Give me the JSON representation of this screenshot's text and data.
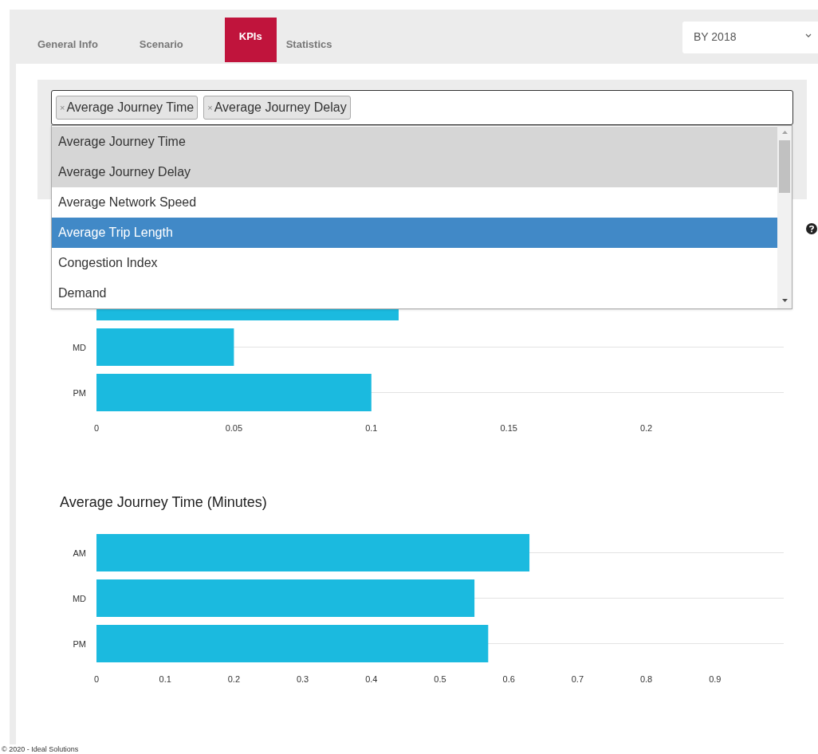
{
  "tabs": [
    {
      "label": "General Info",
      "selected": false
    },
    {
      "label": "Scenario",
      "selected": false
    },
    {
      "label": "KPIs",
      "selected": true
    },
    {
      "label": "Statistics",
      "selected": false
    }
  ],
  "year_select": {
    "value": "BY 2018"
  },
  "kpi_select": {
    "tags": [
      {
        "remove": "×",
        "label": "Average Journey Time"
      },
      {
        "remove": "×",
        "label": "Average Journey Delay"
      }
    ],
    "options": [
      {
        "label": "Average Journey Time",
        "selected": true,
        "hovered": false
      },
      {
        "label": "Average Journey Delay",
        "selected": true,
        "hovered": false
      },
      {
        "label": "Average Network Speed",
        "selected": false,
        "hovered": false
      },
      {
        "label": "Average Trip Length",
        "selected": false,
        "hovered": true
      },
      {
        "label": "Congestion Index",
        "selected": false,
        "hovered": false
      },
      {
        "label": "Demand",
        "selected": false,
        "hovered": false
      }
    ]
  },
  "charts": [
    {
      "clipped_bar": true,
      "chart_data": {
        "type": "bar",
        "orientation": "horizontal",
        "categories": [
          "MD",
          "PM"
        ],
        "series": [
          {
            "color": "#1bbadf",
            "values": [
              0.05,
              0.1
            ]
          }
        ],
        "xlim": [
          0,
          0.25
        ],
        "xticks": [
          0,
          0.05,
          0.1,
          0.15,
          0.2
        ]
      }
    },
    {
      "chart_data": {
        "type": "bar",
        "orientation": "horizontal",
        "title": "Average Journey Time (Minutes)",
        "categories": [
          "AM",
          "MD",
          "PM"
        ],
        "series": [
          {
            "color": "#1bbadf",
            "values": [
              0.63,
              0.55,
              0.57
            ]
          }
        ],
        "xlim": [
          0,
          1
        ],
        "xticks": [
          0,
          0.1,
          0.2,
          0.3,
          0.4,
          0.5,
          0.6,
          0.7,
          0.8,
          0.9
        ]
      }
    }
  ],
  "footer": "© 2020 - Ideal Solutions"
}
